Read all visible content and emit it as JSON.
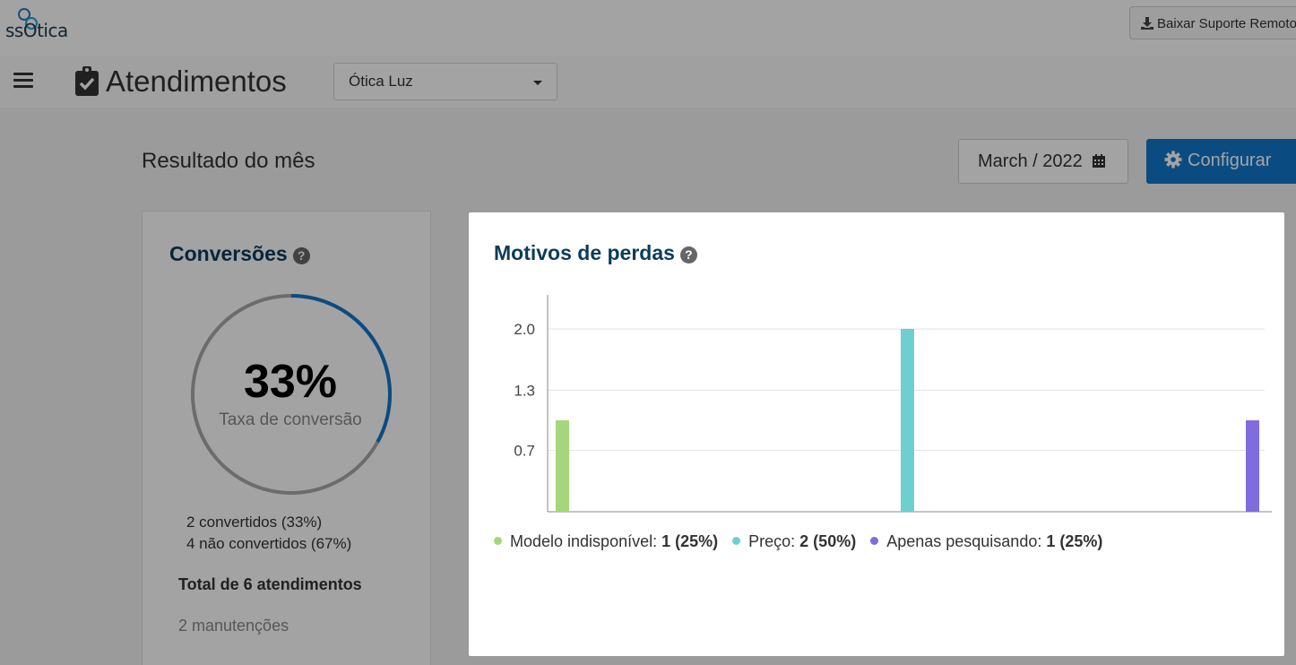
{
  "app": {
    "logo_text": "ssOtica",
    "download_label": "Baixar Suporte Remoto"
  },
  "header": {
    "title": "Atendimentos",
    "store_selected": "Ótica Luz"
  },
  "main": {
    "section_title": "Resultado do mês",
    "month_label": "March / 2022",
    "config_label": "Configurar"
  },
  "conversions": {
    "title": "Conversões",
    "help": "?",
    "percent": "33%",
    "percent_value": 0.33,
    "percent_label": "Taxa de conversão",
    "converted": "2 convertidos (33%)",
    "not_converted": "4 não convertidos (67%)",
    "total": "Total de 6 atendimentos",
    "maintenance": "2 manutenções"
  },
  "losses": {
    "title": "Motivos de perdas",
    "help": "?",
    "legend": [
      {
        "label": "Modelo indisponível:",
        "value": "1 (25%)",
        "color": "#a6d67b"
      },
      {
        "label": "Preço:",
        "value": "2 (50%)",
        "color": "#6dcfd1"
      },
      {
        "label": "Apenas pesquisando:",
        "value": "1 (25%)",
        "color": "#7f6de0"
      }
    ]
  },
  "chart_data": {
    "type": "bar",
    "categories": [
      "Modelo indisponível",
      "Preço",
      "Apenas pesquisando"
    ],
    "values": [
      1,
      2,
      1
    ],
    "colors": [
      "#a6d67b",
      "#6dcfd1",
      "#7f6de0"
    ],
    "yticks": [
      "2.0",
      "1.3",
      "0.7"
    ],
    "ytick_values": [
      2.0,
      1.33,
      0.67
    ],
    "ylim": [
      0,
      2.35
    ],
    "grid": true
  },
  "colors": {
    "primary": "#1177cc",
    "title": "#0c3c5a",
    "ring_track": "#aaaaaa"
  }
}
